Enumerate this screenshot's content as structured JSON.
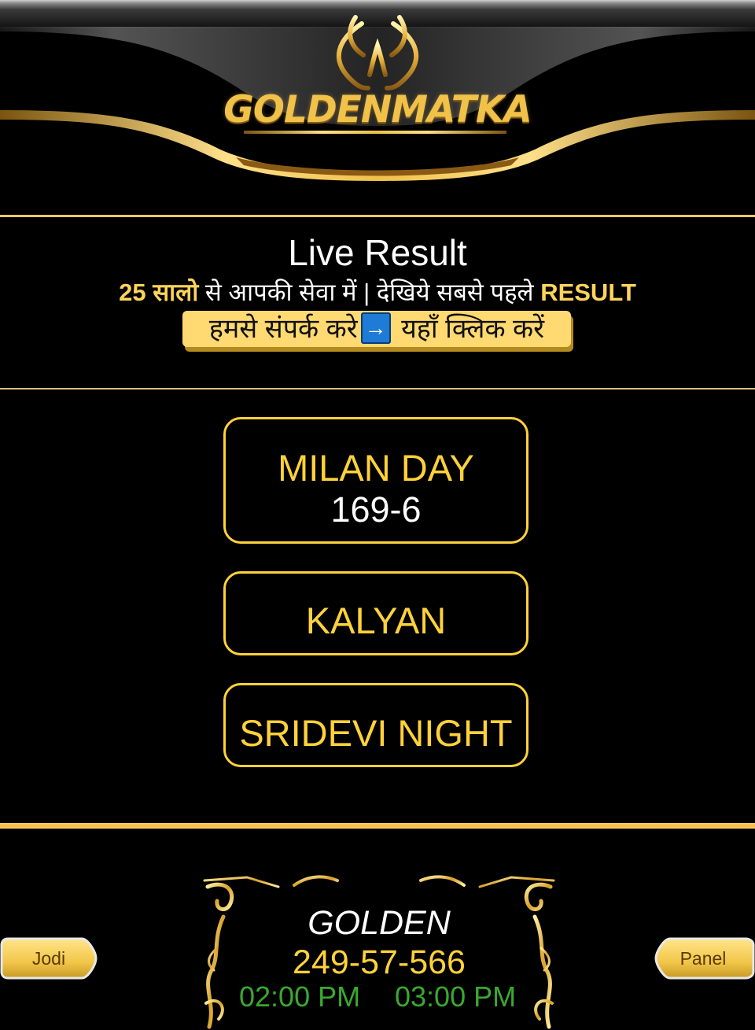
{
  "header": {
    "logo_text": "GOLDENMATKA"
  },
  "live": {
    "title": "Live Result",
    "tagline_gold_1": "25 सालो",
    "tagline_middle": " से आपकी सेवा में | देखिये सबसे पहले ",
    "tagline_gold_2": "RESULT",
    "contact_label_1": "हमसे संपर्क करे",
    "contact_arrow": "→",
    "contact_label_2": " यहाँ क्लिक करें"
  },
  "markets": [
    {
      "name": "MILAN DAY",
      "result": "169-6"
    },
    {
      "name": "KALYAN",
      "result": ""
    },
    {
      "name": "SRIDEVI NIGHT",
      "result": ""
    }
  ],
  "featured": {
    "name": "GOLDEN",
    "result": "249-57-566",
    "open_time": "02:00 PM",
    "close_time": "03:00 PM",
    "jodi_label": "Jodi",
    "panel_label": "Panel"
  },
  "colors": {
    "gold": "#ffd23a",
    "time_green": "#3aa82f",
    "background": "#000000"
  },
  "icons": {
    "logo_ornament": "lotus-crown-icon",
    "contact_arrow": "right-arrow-icon",
    "frame": "ornate-gold-frame"
  }
}
